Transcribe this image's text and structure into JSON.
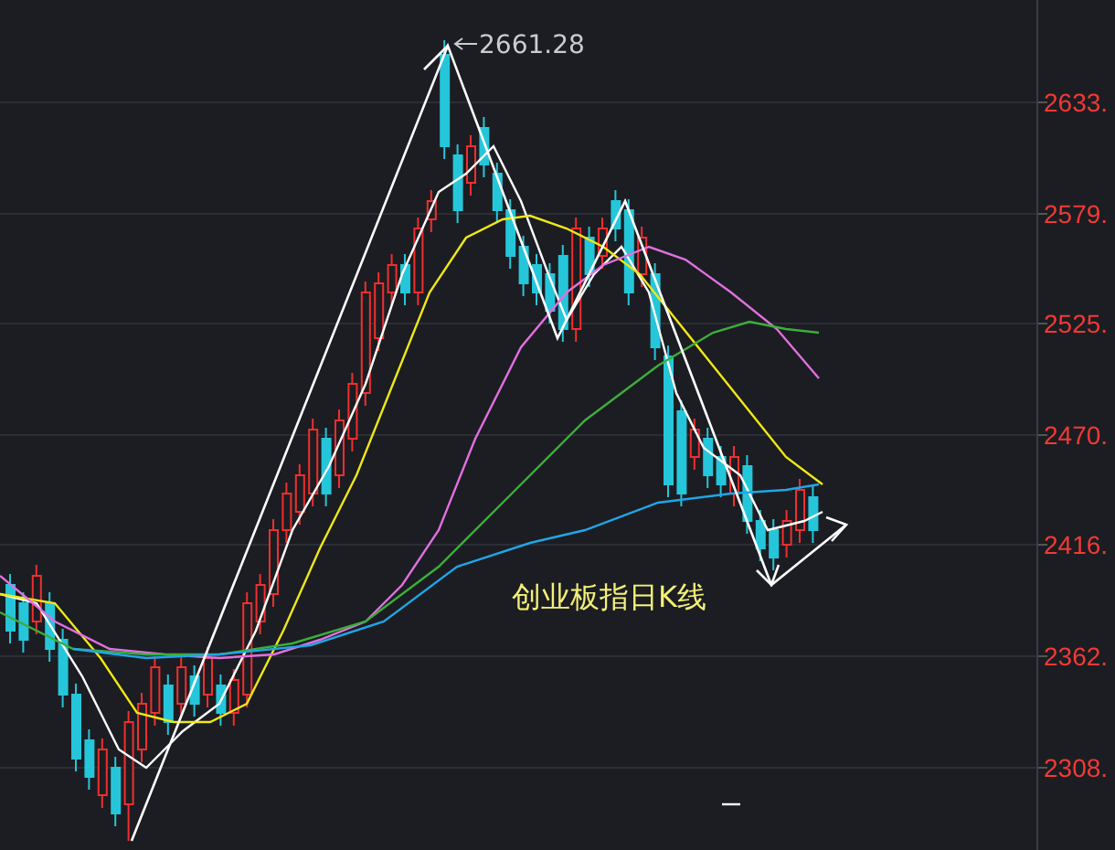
{
  "chart": {
    "title": "创业板指日K线",
    "peak_label": "2661.28",
    "price_axis": {
      "labels": [
        "2633.",
        "2579.",
        "2525.",
        "2470.",
        "2416.",
        "2362.",
        "2308."
      ]
    }
  }
}
